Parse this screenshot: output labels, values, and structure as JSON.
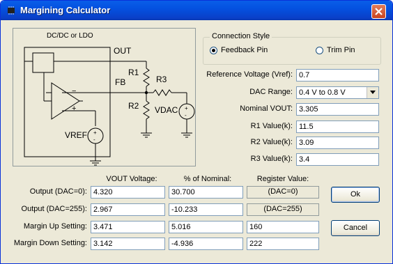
{
  "window": {
    "title": "Margining Calculator",
    "icon": "chip-icon"
  },
  "schematic": {
    "box_title": "DC/DC or LDO",
    "labels": {
      "out": "OUT",
      "fb": "FB",
      "r1": "R1",
      "r2": "R2",
      "r3": "R3",
      "vdac": "VDAC",
      "vref": "VREF",
      "minus": "−",
      "plus": "+"
    }
  },
  "connection": {
    "legend": "Connection Style",
    "options": [
      {
        "label": "Feedback Pin",
        "selected": true
      },
      {
        "label": "Trim Pin",
        "selected": false
      }
    ]
  },
  "inputs": {
    "vref_label": "Reference Voltage (Vref):",
    "vref_value": "0.7",
    "dac_label": "DAC Range:",
    "dac_value": "0.4 V to 0.8 V",
    "vout_label": "Nominal VOUT:",
    "vout_value": "3.305",
    "r1_label": "R1 Value(k):",
    "r1_value": "11.5",
    "r2_label": "R2 Value(k):",
    "r2_value": "3.09",
    "r3_label": "R3 Value(k):",
    "r3_value": "3.4"
  },
  "results": {
    "headers": {
      "vout": "VOUT Voltage:",
      "pct": "% of Nominal:",
      "reg": "Register Value:"
    },
    "rows": [
      {
        "label": "Output (DAC=0):",
        "vout": "4.320",
        "pct": "30.700",
        "reg": "(DAC=0)"
      },
      {
        "label": "Output (DAC=255):",
        "vout": "2.967",
        "pct": "-10.233",
        "reg": "(DAC=255)"
      },
      {
        "label": "Margin Up Setting:",
        "vout": "3.471",
        "pct": "5.016",
        "reg": "160"
      },
      {
        "label": "Margin Down Setting:",
        "vout": "3.142",
        "pct": "-4.936",
        "reg": "222"
      }
    ]
  },
  "buttons": {
    "ok": "Ok",
    "cancel": "Cancel"
  }
}
